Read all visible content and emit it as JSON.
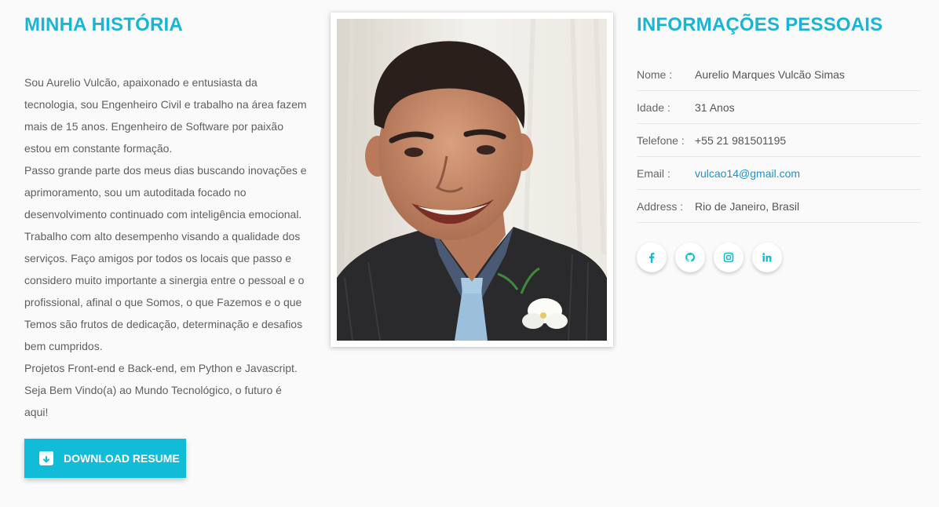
{
  "about": {
    "heading": "MINHA HISTÓRIA",
    "paragraphs": [
      "Sou Aurelio Vulcão, apaixonado e entusiasta da tecnologia, sou Engenheiro Civil e trabalho na área fazem mais de 15 anos. Engenheiro de Software por paixão estou em constante formação.",
      "Passo grande parte dos meus dias buscando inovações e aprimoramento, sou um autoditada focado no desenvolvimento continuado com inteligência emocional. Trabalho com alto desempenho visando a qualidade dos serviços. Faço amigos por todos os locais que passo e considero muito importante a sinergia entre o pessoal e o profissional, afinal o que Somos, o que Fazemos e o que Temos são frutos de dedicação, determinação e desafios bem cumpridos.",
      "Projetos Front-end e Back-end, em Python e Javascript.",
      "Seja Bem Vindo(a) ao Mundo Tecnológico, o futuro é aqui!"
    ],
    "download_label": "DOWNLOAD RESUME",
    "download_icon": "archive-download-icon"
  },
  "photo": {
    "icon": "profile-photo"
  },
  "personal": {
    "heading": "INFORMAÇÕES PESSOAIS",
    "rows": [
      {
        "label": "Nome :",
        "value": "Aurelio Marques Vulcão Simas"
      },
      {
        "label": "Idade :",
        "value": "31 Anos"
      },
      {
        "label": "Telefone :",
        "value": "+55 21 981501195"
      },
      {
        "label": "Email :",
        "value": "vulcao14@gmail.com"
      },
      {
        "label": "Address :",
        "value": "Rio de Janeiro, Brasil"
      }
    ],
    "socials": [
      "facebook-icon",
      "github-icon",
      "instagram-icon",
      "linkedin-icon"
    ],
    "accent_color": "#1ab5d3",
    "link_color": "#1a93d2"
  }
}
